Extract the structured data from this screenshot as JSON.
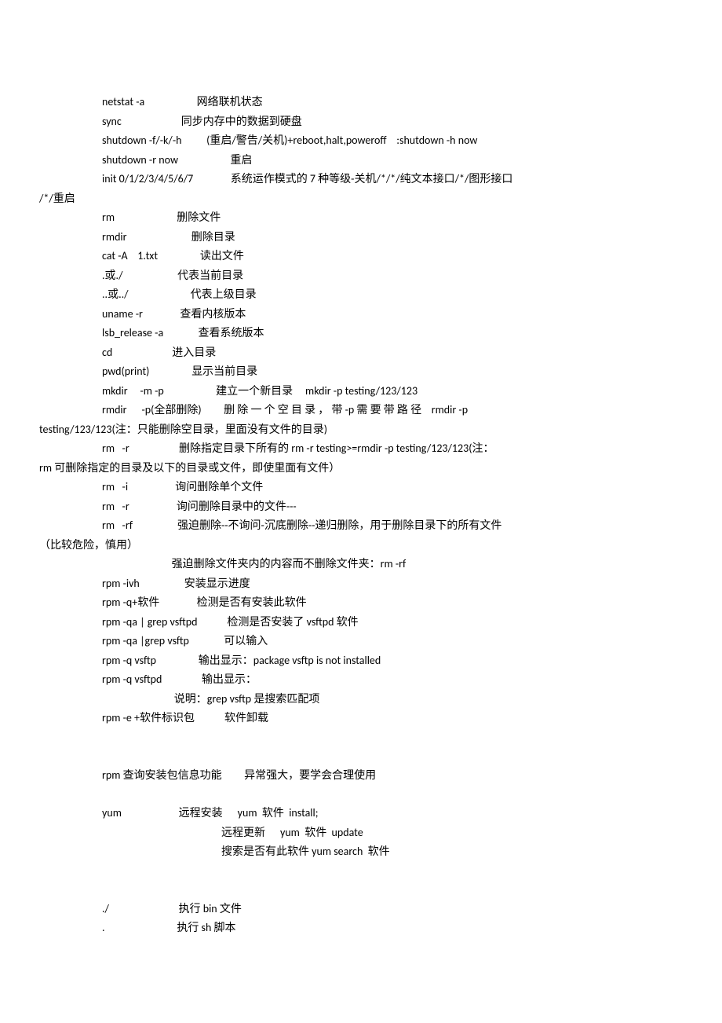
{
  "lines": [
    {
      "cls": "line",
      "text": "netstat -a                     网络联机状态"
    },
    {
      "cls": "line",
      "text": "sync                        同步内存中的数据到硬盘"
    },
    {
      "cls": "line",
      "text": "shutdown -f/-k/-h          (重启/警告/关机)+reboot,halt,poweroff    :shutdown -h now"
    },
    {
      "cls": "line",
      "text": "shutdown -r now                     重启"
    },
    {
      "cls": "line",
      "text": "init 0/1/2/3/4/5/6/7               系统运作模式的 7 种等级-关机/*/*/纯文本接口/*/图形接口"
    },
    {
      "cls": "line continue",
      "text": "/*/重启"
    },
    {
      "cls": "line",
      "text": "rm                         删除文件"
    },
    {
      "cls": "line",
      "text": "rmdir                          删除目录"
    },
    {
      "cls": "line",
      "text": "cat -A    1.txt                 读出文件"
    },
    {
      "cls": "line",
      "text": ".或./                      代表当前目录"
    },
    {
      "cls": "line",
      "text": "..或../                         代表上级目录"
    },
    {
      "cls": "line",
      "text": "uname -r               查看内核版本"
    },
    {
      "cls": "line",
      "text": "lsb_release -a              查看系统版本"
    },
    {
      "cls": "line",
      "text": "cd                        进入目录"
    },
    {
      "cls": "line",
      "text": "pwd(print)                 显示当前目录"
    },
    {
      "cls": "line",
      "text": "mkdir     -m -p                     建立一个新目录     mkdir -p testing/123/123"
    },
    {
      "cls": "line",
      "text": "rmdir      -p(全部删除)         删 除 一 个 空 目 录 ， 带 -p 需 要 带 路 径    rmdir -p"
    },
    {
      "cls": "line continue",
      "text": "testing/123/123(注：只能删除空目录，里面没有文件的目录)"
    },
    {
      "cls": "line",
      "text": "rm   -r                    删除指定目录下所有的 rm -r testing>=rmdir -p testing/123/123(注："
    },
    {
      "cls": "line continue",
      "text": "rm 可删除指定的目录及以下的目录或文件，即使里面有文件）"
    },
    {
      "cls": "line",
      "text": "rm   -i                   询问删除单个文件"
    },
    {
      "cls": "line",
      "text": "rm   -r                   询问删除目录中的文件---"
    },
    {
      "cls": "line",
      "text": "rm   -rf                  强迫删除--不询问-沉底删除--递归删除，用于删除目录下的所有文件"
    },
    {
      "cls": "line continue",
      "text": "（比较危险，慎用）"
    },
    {
      "cls": "line",
      "text": "                            强迫删除文件夹内的内容而不删除文件夹：rm -rf"
    },
    {
      "cls": "line",
      "text": "rpm -ivh                  安装显示进度"
    },
    {
      "cls": "line",
      "text": "rpm -q+软件               检测是否有安装此软件"
    },
    {
      "cls": "line",
      "text": "rpm -qa | grep vsftpd            检测是否安装了 vsftpd 软件"
    },
    {
      "cls": "line",
      "text": "rpm -qa |grep vsftp              可以输入"
    },
    {
      "cls": "line",
      "text": "rpm -q vsftp                 输出显示：package vsftp is not installed"
    },
    {
      "cls": "line",
      "text": "rpm -q vsftpd                输出显示："
    },
    {
      "cls": "line",
      "text": "                             说明：grep vsftp 是搜索匹配项"
    },
    {
      "cls": "line",
      "text": "rpm -e +软件标识包            软件卸载"
    },
    {
      "cls": "blank",
      "text": ""
    },
    {
      "cls": "blank",
      "text": ""
    },
    {
      "cls": "line",
      "text": "rpm 查询安装包信息功能         异常强大，要学会合理使用"
    },
    {
      "cls": "blank",
      "text": ""
    },
    {
      "cls": "line",
      "text": "yum                       远程安装      yum  软件  install;"
    },
    {
      "cls": "line sub",
      "text": "远程更新      yum  软件  update"
    },
    {
      "cls": "line sub",
      "text": "搜索是否有此软件 yum search  软件"
    },
    {
      "cls": "blank",
      "text": ""
    },
    {
      "cls": "blank",
      "text": ""
    },
    {
      "cls": "line",
      "text": "./                            执行 bin 文件"
    },
    {
      "cls": "line",
      "text": ".                             执行 sh 脚本"
    }
  ]
}
